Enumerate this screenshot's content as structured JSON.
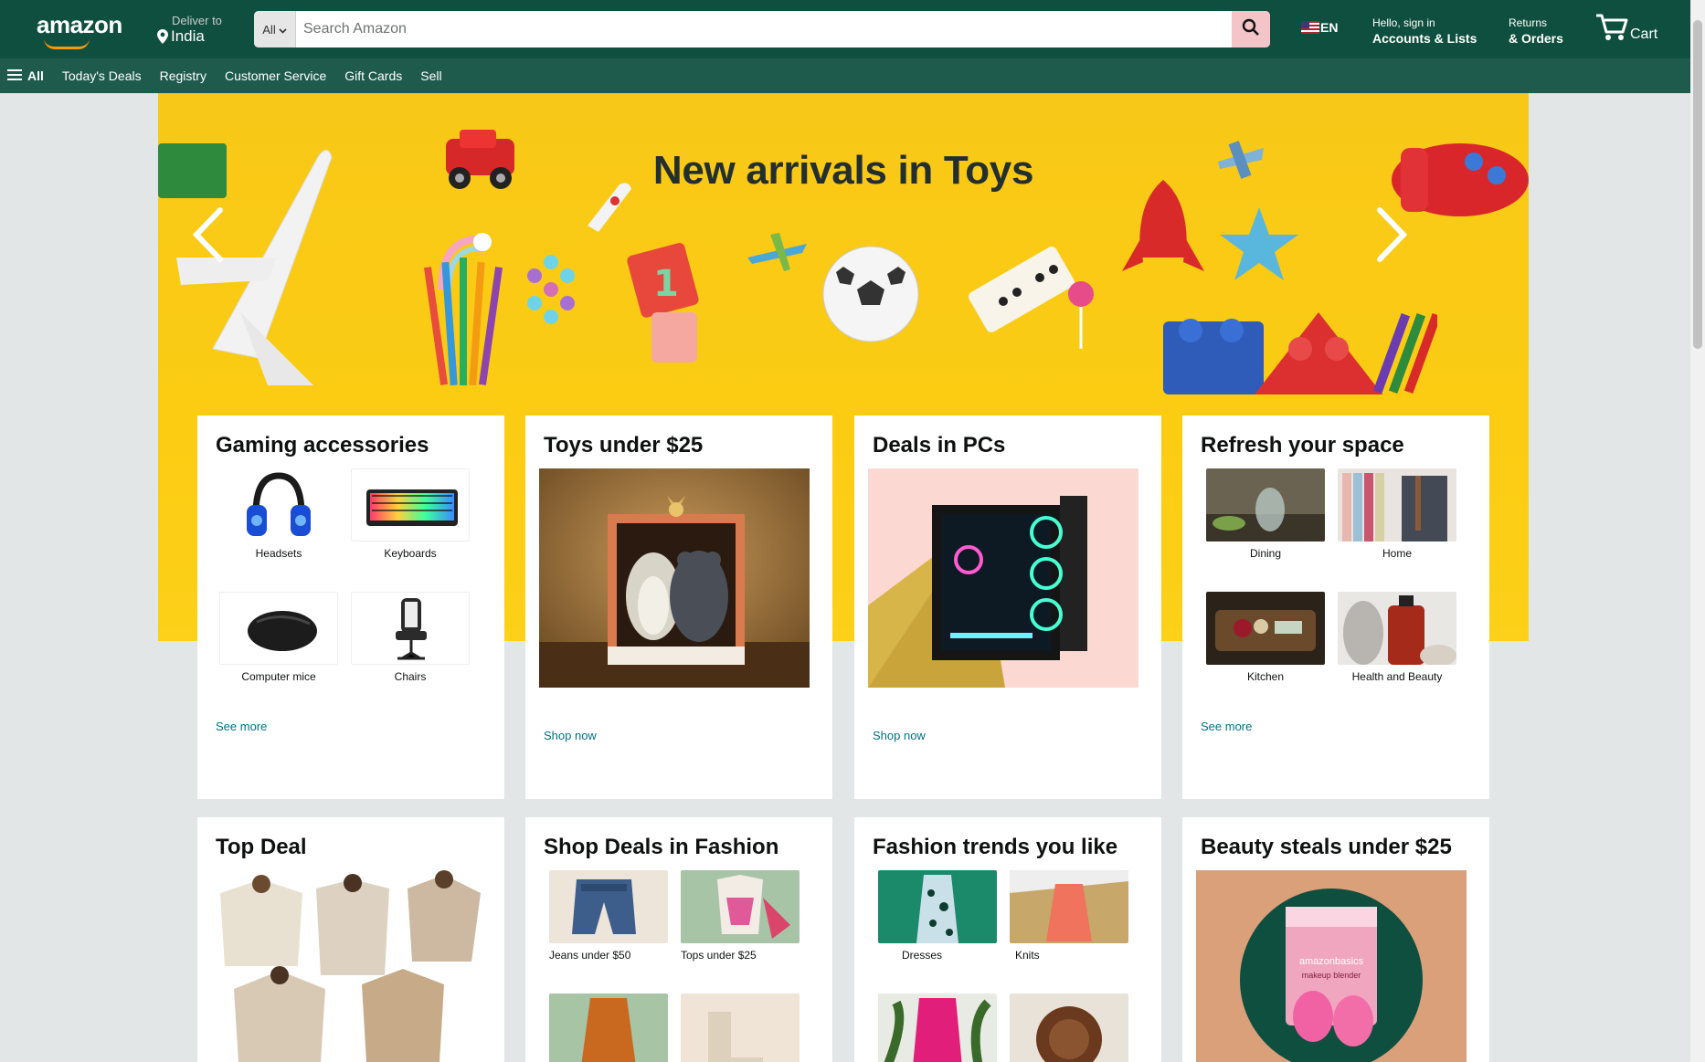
{
  "header": {
    "logo_text": "amazon",
    "deliver_label": "Deliver to",
    "deliver_location": "India",
    "search_category": "All",
    "search_placeholder": "Search Amazon",
    "language": "EN",
    "account_greeting": "Hello, sign in",
    "account_label": "Accounts & Lists",
    "returns_label": "Returns",
    "orders_label": "& Orders",
    "cart_label": "Cart",
    "colors": {
      "nav_bg": "#0f4f3f",
      "subnav_bg": "#1f5b4d",
      "search_button": "#f3c5c9"
    }
  },
  "subnav": {
    "all_label": "All",
    "items": [
      "Today's Deals",
      "Registry",
      "Customer Service",
      "Gift Cards",
      "Sell"
    ]
  },
  "hero": {
    "title": "New arrivals in Toys",
    "background_color": "#fbcc12"
  },
  "cards": [
    {
      "title": "Gaming accessories",
      "items": [
        "Headsets",
        "Keyboards",
        "Computer mice",
        "Chairs"
      ],
      "link": "See more"
    },
    {
      "title": "Toys under $25",
      "link": "Shop now"
    },
    {
      "title": "Deals in PCs",
      "link": "Shop now"
    },
    {
      "title": "Refresh your space",
      "items": [
        "Dining",
        "Home",
        "Kitchen",
        "Health and Beauty"
      ],
      "link": "See more"
    },
    {
      "title": "Top Deal"
    },
    {
      "title": "Shop Deals in Fashion",
      "items": [
        "Jeans under $50",
        "Tops under $25"
      ]
    },
    {
      "title": "Fashion trends you like",
      "items": [
        "Dresses",
        "Knits"
      ]
    },
    {
      "title": "Beauty steals under $25",
      "product_text_1": "amazonbasics",
      "product_text_2": "makeup blender"
    }
  ]
}
